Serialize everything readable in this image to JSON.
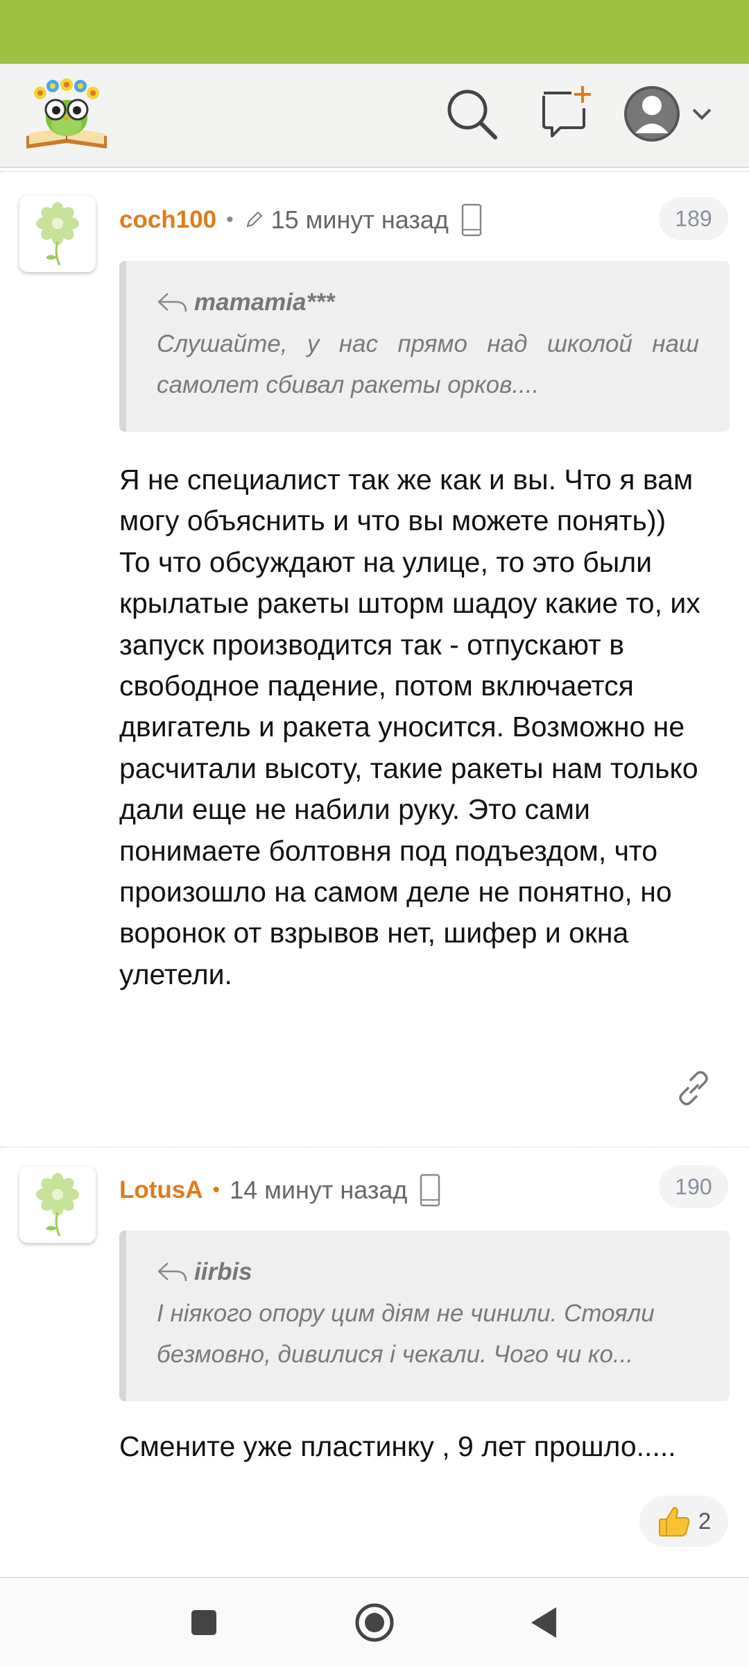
{
  "header": {
    "logo_icon": "owl-on-book-logo",
    "search_icon": "search-icon",
    "new_post_icon": "new-message-plus-icon",
    "profile_icon": "user-avatar-icon",
    "brand_color": "#9ec142"
  },
  "comments": [
    {
      "username": "coch100",
      "separator": "•",
      "edited": true,
      "time": "15 минут назад",
      "device": "mobile",
      "number": "189",
      "quote": {
        "author": "mamamia***",
        "text": "Слушайте, у нас прямо над школой наш самолет сбивал ракеты орков...."
      },
      "body": "Я не специалист так же как и вы. Что я вам могу объяснить и что вы можете понять))\nТо что обсуждают на улице, то это были крылатые ракеты шторм шадоу какие то, их запуск производится так - отпускают в свободное падение, потом включается двигатель и ракета уносится. Возможно не расчитали высоту, такие ракеты нам только дали еще не набили руку. Это сами понимаете болтовня под подъездом, что произошло на самом деле не понятно, но воронок от взрывов нет, шифер и окна улетели."
    },
    {
      "username": "LotusA",
      "separator": "•",
      "time": "14 минут назад",
      "device": "mobile",
      "number": "190",
      "quote": {
        "author": "iirbis",
        "line1": "І ніякого опору цим діям не чинили. Стояли",
        "line2": "безмовно, дивилися і чекали. Чого чи ко..."
      },
      "body": "Смените уже пластинку , 9 лет прошло.....",
      "reaction": {
        "icon": "thumbs-up-icon",
        "count": "2"
      }
    }
  ],
  "nav": {
    "recent_icon": "square-icon",
    "home_icon": "circle-home-icon",
    "back_icon": "triangle-back-icon"
  }
}
